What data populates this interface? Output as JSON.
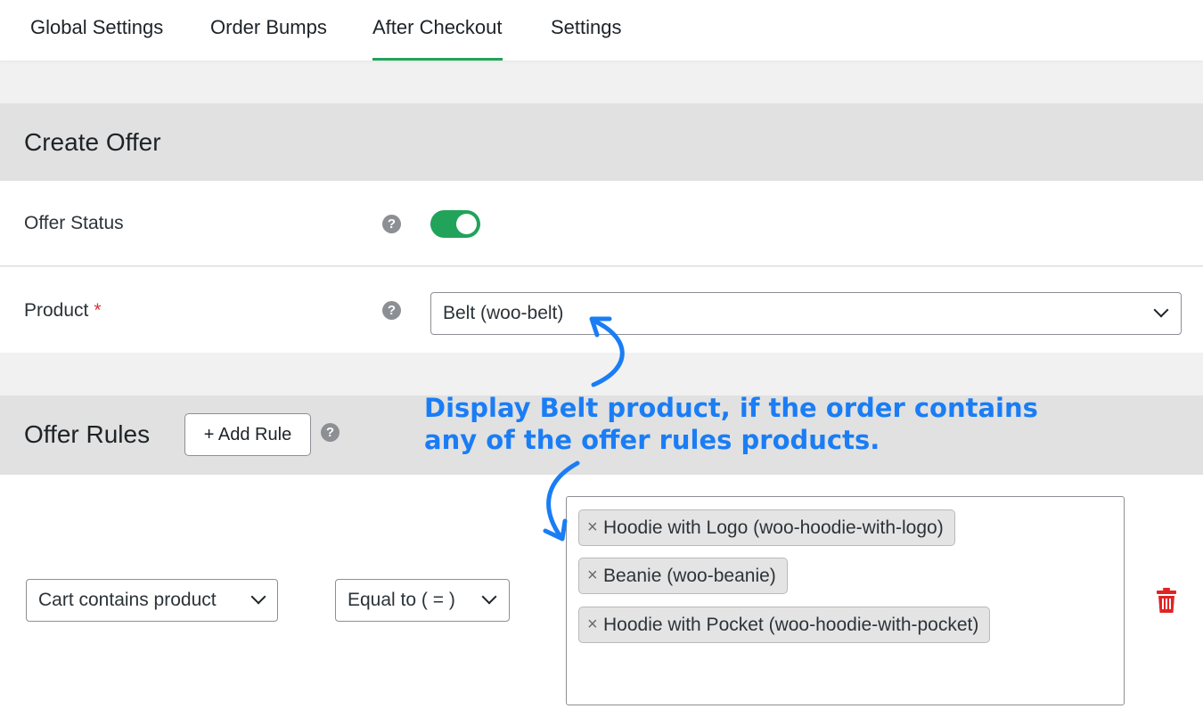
{
  "tabs": [
    {
      "label": "Global Settings"
    },
    {
      "label": "Order Bumps"
    },
    {
      "label": "After Checkout",
      "active": true
    },
    {
      "label": "Settings"
    }
  ],
  "create_offer": {
    "title": "Create Offer",
    "offer_status": {
      "label": "Offer Status",
      "enabled": true,
      "help_icon": "?"
    },
    "product": {
      "label": "Product",
      "required_mark": "*",
      "help_icon": "?",
      "value": "Belt (woo-belt)"
    }
  },
  "offer_rules": {
    "title": "Offer Rules",
    "add_rule_label": "+ Add Rule",
    "help_icon": "?",
    "rule": {
      "condition": "Cart contains product",
      "operator": "Equal to ( = )",
      "products": [
        "Hoodie with Logo (woo-hoodie-with-logo)",
        "Beanie (woo-beanie)",
        "Hoodie with Pocket (woo-hoodie-with-pocket)"
      ],
      "remove_chip_glyph": "×"
    }
  },
  "annotation": {
    "line1": "Display Belt product, if the order contains",
    "line2": "any of the offer rules products."
  },
  "colors": {
    "accent_green": "#21a35a",
    "annotation_blue": "#1a7df5",
    "delete_red": "#e02424",
    "required_red": "#d63638"
  },
  "icons": [
    "help-icon",
    "chevron-down-icon",
    "trash-icon",
    "remove-chip-icon"
  ]
}
